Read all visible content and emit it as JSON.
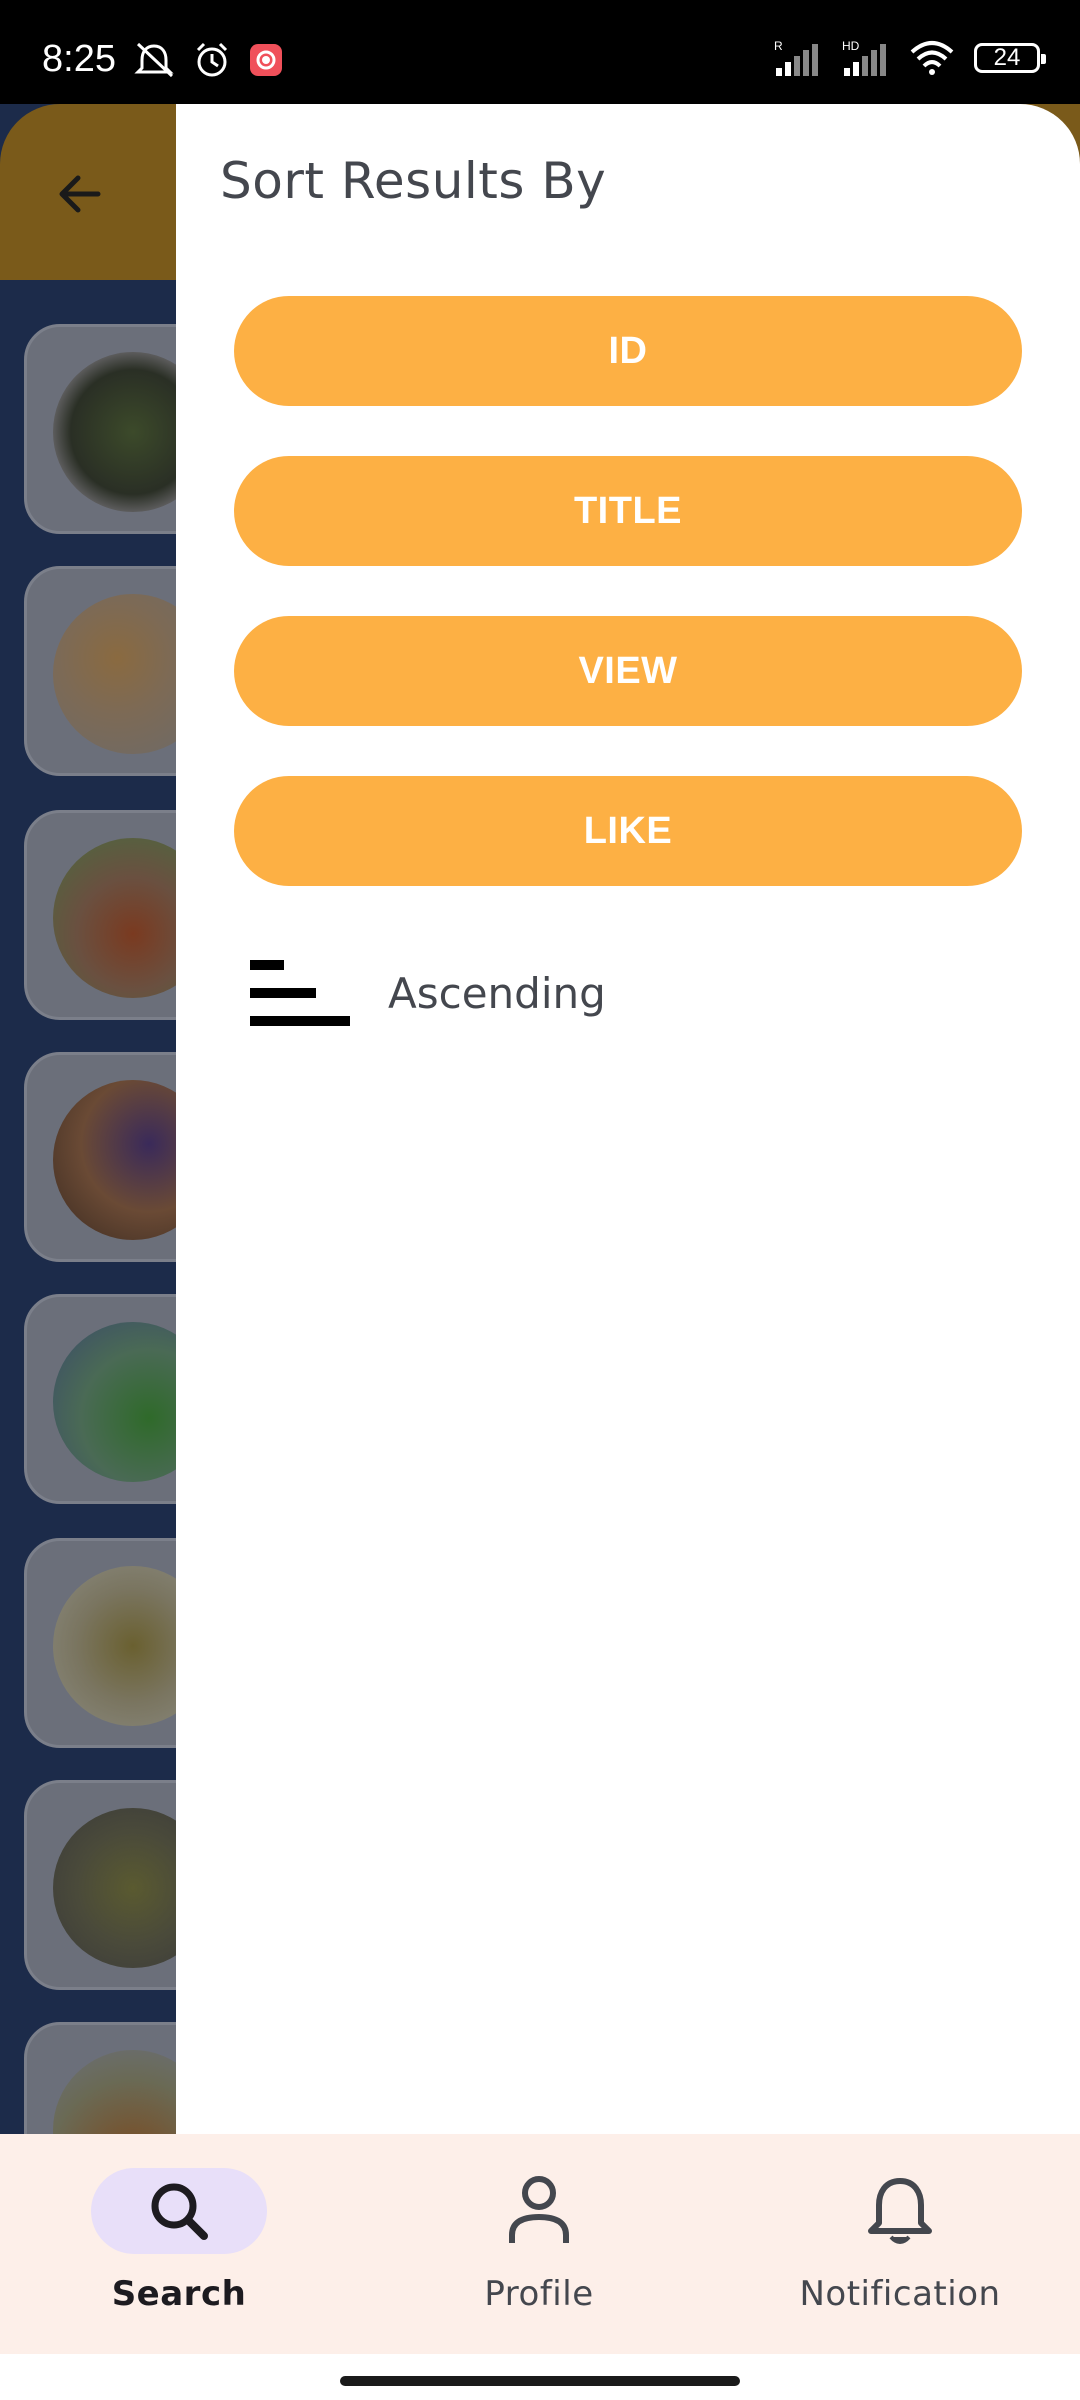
{
  "status_bar": {
    "time": "8:25",
    "battery": "24",
    "left_icons": [
      "mute-vibrate-icon",
      "alarm-icon",
      "screen-record-icon"
    ],
    "right_icons": [
      "signal-r-icon",
      "signal-hd-icon",
      "wifi-icon",
      "battery-icon"
    ]
  },
  "background_app": {
    "back_icon": "arrow-back-icon",
    "appbar_color": "#7a5a1a"
  },
  "drawer": {
    "title": "Sort Results By",
    "sort_options": [
      "ID",
      "TITLE",
      "VIEW",
      "LIKE"
    ],
    "order_label": "Ascending",
    "order_icon": "sort-ascending-icon",
    "button_color": "#fdb044"
  },
  "bottom_nav": {
    "items": [
      {
        "label": "Search",
        "icon": "search-icon",
        "active": true
      },
      {
        "label": "Profile",
        "icon": "person-icon",
        "active": false
      },
      {
        "label": "Notification",
        "icon": "bell-icon",
        "active": false
      }
    ],
    "active_indicator_color": "#e8dff9",
    "background_color": "#fdefe9"
  }
}
